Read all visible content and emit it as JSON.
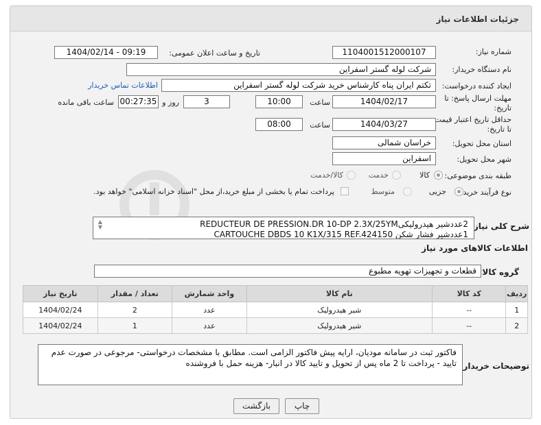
{
  "header": {
    "title": "جزئیات اطلاعات نیاز"
  },
  "form": {
    "need_number": {
      "label": "شماره نیاز:",
      "value": "1104001512000107"
    },
    "announce_datetime": {
      "label": "تاریخ و ساعت اعلان عمومی:",
      "value": "1404/02/14 - 09:19"
    },
    "buyer_org": {
      "label": "نام دستگاه خریدار:",
      "value": "شرکت لوله گستر اسفراین"
    },
    "requester": {
      "label": "ایجاد کننده درخواست:",
      "value": "تکتم ایران پناه کارشناس خرید شرکت لوله گستر اسفراین"
    },
    "contact_link": "اطلاعات تماس خریدار",
    "reply_deadline": {
      "label_line1": "مهلت ارسال پاسخ: تا",
      "label_line2": "تاریخ:",
      "date": "1404/02/17",
      "time_label": "ساعت",
      "time": "10:00",
      "days": "3",
      "days_label": "روز و",
      "remaining": "00:27:35",
      "remaining_label": "ساعت باقی مانده"
    },
    "price_validity": {
      "label_line1": "حداقل تاریخ اعتبار قیمت:",
      "label_line2": "تا تاریخ:",
      "date": "1404/03/27",
      "time_label": "ساعت",
      "time": "08:00"
    },
    "province": {
      "label": "استان محل تحویل:",
      "value": "خراسان شمالی"
    },
    "city": {
      "label": "شهر محل تحویل:",
      "value": "اسفراین"
    },
    "category": {
      "label": "طبقه بندی موضوعی:",
      "options": [
        "کالا",
        "خدمت",
        "کالا/خدمت"
      ],
      "selected": "کالا"
    },
    "purchase_process": {
      "label": "نوع فرآیند خرید :",
      "options": [
        "جزیی",
        "متوسط"
      ],
      "selected": "جزیی",
      "payment_note": "پرداخت تمام یا بخشی از مبلغ خرید،از محل \"اسناد خزانه اسلامی\" خواهد بود."
    },
    "overall_desc": {
      "label": "شرح کلی نیاز:",
      "line1": "2عددشیر هیدرولیکیREDUCTEUR DE PRESSION.DR 10-DP 2.3X/25YM",
      "line2": "1عددشیر فشار شکن CARTOUCHE DBDS 10 K1X/315 REF.424150"
    },
    "goods_info_title": "اطلاعات کالاهای مورد نیاز",
    "goods_group": {
      "label": "گروه کالا:",
      "value": "قطعات و تجهیزات تهویه مطبوع"
    }
  },
  "table": {
    "columns": [
      "ردیف",
      "کد کالا",
      "نام کالا",
      "واحد شمارش",
      "تعداد / مقدار",
      "تاریخ نیاز"
    ],
    "rows": [
      [
        "1",
        "--",
        "شیر هیدرولیک",
        "عدد",
        "2",
        "1404/02/24"
      ],
      [
        "2",
        "--",
        "شیر هیدرولیک",
        "عدد",
        "1",
        "1404/02/24"
      ]
    ]
  },
  "buyer_notes": {
    "label": "توضیحات خریدار:",
    "value": "فاکتور ثبت در سامانه مودیان، ارایه پیش فاکتور الزامی است. مطابق با مشخصات درخواستی- مرجوعی در صورت عدم تایید - پرداخت تا 2 ماه پس از تحویل و تایید کالا در انبار- هزینه حمل با فروشنده"
  },
  "buttons": {
    "print": "چاپ",
    "back": "بازگشت"
  },
  "colors": {
    "link": "#1a5fb4",
    "header_bg": "#e6e6e6",
    "panel_bg": "#f2f2f2"
  }
}
